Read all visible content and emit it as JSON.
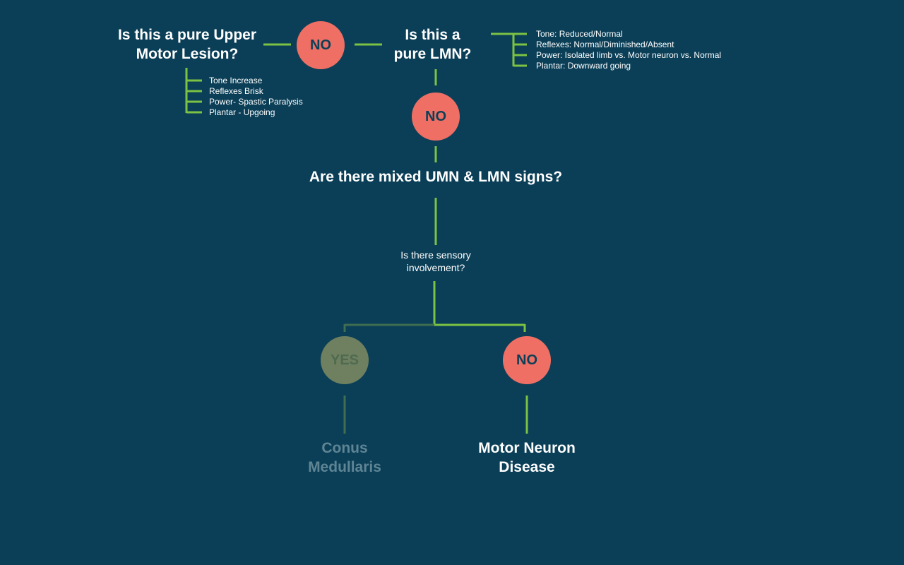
{
  "colors": {
    "background": "#0b3f57",
    "connector": "#7cc243",
    "connector_dim": "#3f6e50",
    "no_circle": "#ef6f64",
    "yes_circle": "#6e8060",
    "text": "#ffffff",
    "text_dim": "#5f8595"
  },
  "umn_question": {
    "line1": "Is this a pure Upper",
    "line2": "Motor Lesion?"
  },
  "umn_no": "NO",
  "umn_features": [
    "Tone Increase",
    "Reflexes Brisk",
    "Power- Spastic Paralysis",
    "Plantar - Upgoing"
  ],
  "lmn_question": {
    "line1": "Is this a",
    "line2": "pure LMN?"
  },
  "lmn_features": [
    "Tone: Reduced/Normal",
    "Reflexes: Normal/Diminished/Absent",
    "Power: Isolated limb vs. Motor neuron vs. Normal",
    "Plantar: Downward going"
  ],
  "lmn_no": "NO",
  "mixed_question": "Are there mixed UMN & LMN signs?",
  "sensory_question": {
    "line1": "Is there sensory",
    "line2": "involvement?"
  },
  "branch_yes": "YES",
  "branch_no": "NO",
  "outcome_yes": {
    "line1": "Conus",
    "line2": "Medullaris"
  },
  "outcome_no": {
    "line1": "Motor Neuron",
    "line2": "Disease"
  }
}
